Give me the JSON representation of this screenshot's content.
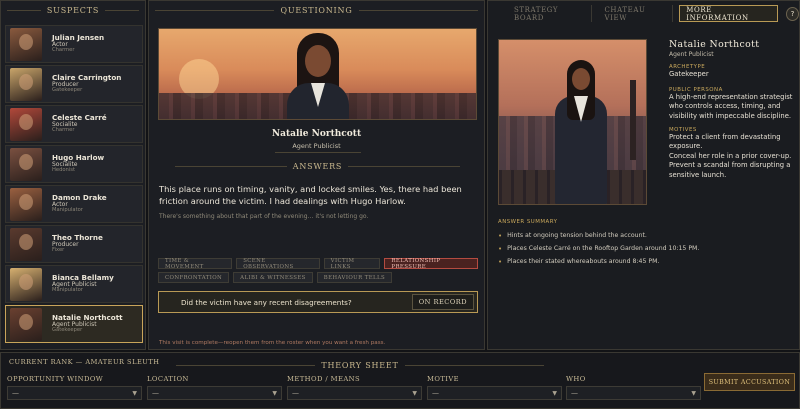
{
  "colors": {
    "gold_accent": "#c9a55a",
    "active_tab_red": "#b44b40",
    "panel_bg": "#1c1e23"
  },
  "suspects_panel": {
    "heading": "SUSPECTS",
    "items": [
      {
        "name": "Julian Jensen",
        "role": "Actor",
        "archetype": "Charmer",
        "tone": "#8a5a3e"
      },
      {
        "name": "Claire Carrington",
        "role": "Producer",
        "archetype": "Gatekeeper",
        "tone": "#c9a56a"
      },
      {
        "name": "Celeste Carré",
        "role": "Socialite",
        "archetype": "Charmer",
        "tone": "#b2483a"
      },
      {
        "name": "Hugo Harlow",
        "role": "Socialite",
        "archetype": "Hedonist",
        "tone": "#7a5040"
      },
      {
        "name": "Damon Drake",
        "role": "Actor",
        "archetype": "Manipulator",
        "tone": "#9a6040"
      },
      {
        "name": "Theo Thorne",
        "role": "Producer",
        "archetype": "Fixer",
        "tone": "#5a3a2e"
      },
      {
        "name": "Bianca Bellamy",
        "role": "Agent Publicist",
        "archetype": "Manipulator",
        "tone": "#d6b070"
      },
      {
        "name": "Natalie Northcott",
        "role": "Agent Publicist",
        "archetype": "Gatekeeper",
        "tone": "#6a4030"
      }
    ]
  },
  "questioning": {
    "heading": "QUESTIONING",
    "name": "Natalie Northcott",
    "role": "Agent Publicist",
    "answers_heading": "ANSWERS",
    "answer": "This place runs on timing, vanity, and locked smiles. Yes, there had been friction around the victim. I had dealings with Hugo Harlow.",
    "answer_sub": "There's something about that part of the evening… it's not letting go.",
    "tabs_row1": [
      "TIME & MOVEMENT",
      "SCENE OBSERVATIONS",
      "VICTIM LINKS",
      "RELATIONSHIP PRESSURE"
    ],
    "tabs_row2": [
      "CONFRONTATION",
      "ALIBI & WITNESSES",
      "BEHAVIOUR TELLS"
    ],
    "active_tab": "RELATIONSHIP PRESSURE",
    "question": "Did the victim have any recent disagreements?",
    "on_record": "ON RECORD",
    "visit_note": "This visit is complete—reopen them from the roster when you want a fresh pass."
  },
  "info_panel": {
    "tabs": [
      "STRATEGY BOARD",
      "CHATEAU VIEW",
      "MORE INFORMATION"
    ],
    "active_tab": "MORE INFORMATION",
    "help_label": "?",
    "name": "Natalie Northcott",
    "role": "Agent Publicist",
    "archetype_label": "ARCHETYPE",
    "archetype": "Gatekeeper",
    "persona_label": "PUBLIC PERSONA",
    "persona": "A high-end representation strategist who controls access, timing, and visibility with impeccable discipline.",
    "motives_label": "MOTIVES",
    "motive_1": "Protect a client from devastating exposure.",
    "motive_2": "Conceal her role in a prior cover-up.",
    "motive_3": "Prevent a scandal from disrupting a sensitive launch.",
    "summary_label": "ANSWER SUMMARY",
    "summary": [
      "Hints at ongoing tension behind the account.",
      "Places Celeste Carré on the Rooftop Garden around 10:15 PM.",
      "Places their stated whereabouts around 8:45 PM."
    ]
  },
  "theory": {
    "rank": "CURRENT RANK — AMATEUR SLEUTH",
    "heading": "THEORY SHEET",
    "fields": [
      {
        "label": "OPPORTUNITY WINDOW",
        "value": "—"
      },
      {
        "label": "LOCATION",
        "value": "—"
      },
      {
        "label": "METHOD / MEANS",
        "value": "—"
      },
      {
        "label": "MOTIVE",
        "value": "—"
      },
      {
        "label": "WHO",
        "value": "—"
      }
    ],
    "submit": "SUBMIT ACCUSATION"
  }
}
